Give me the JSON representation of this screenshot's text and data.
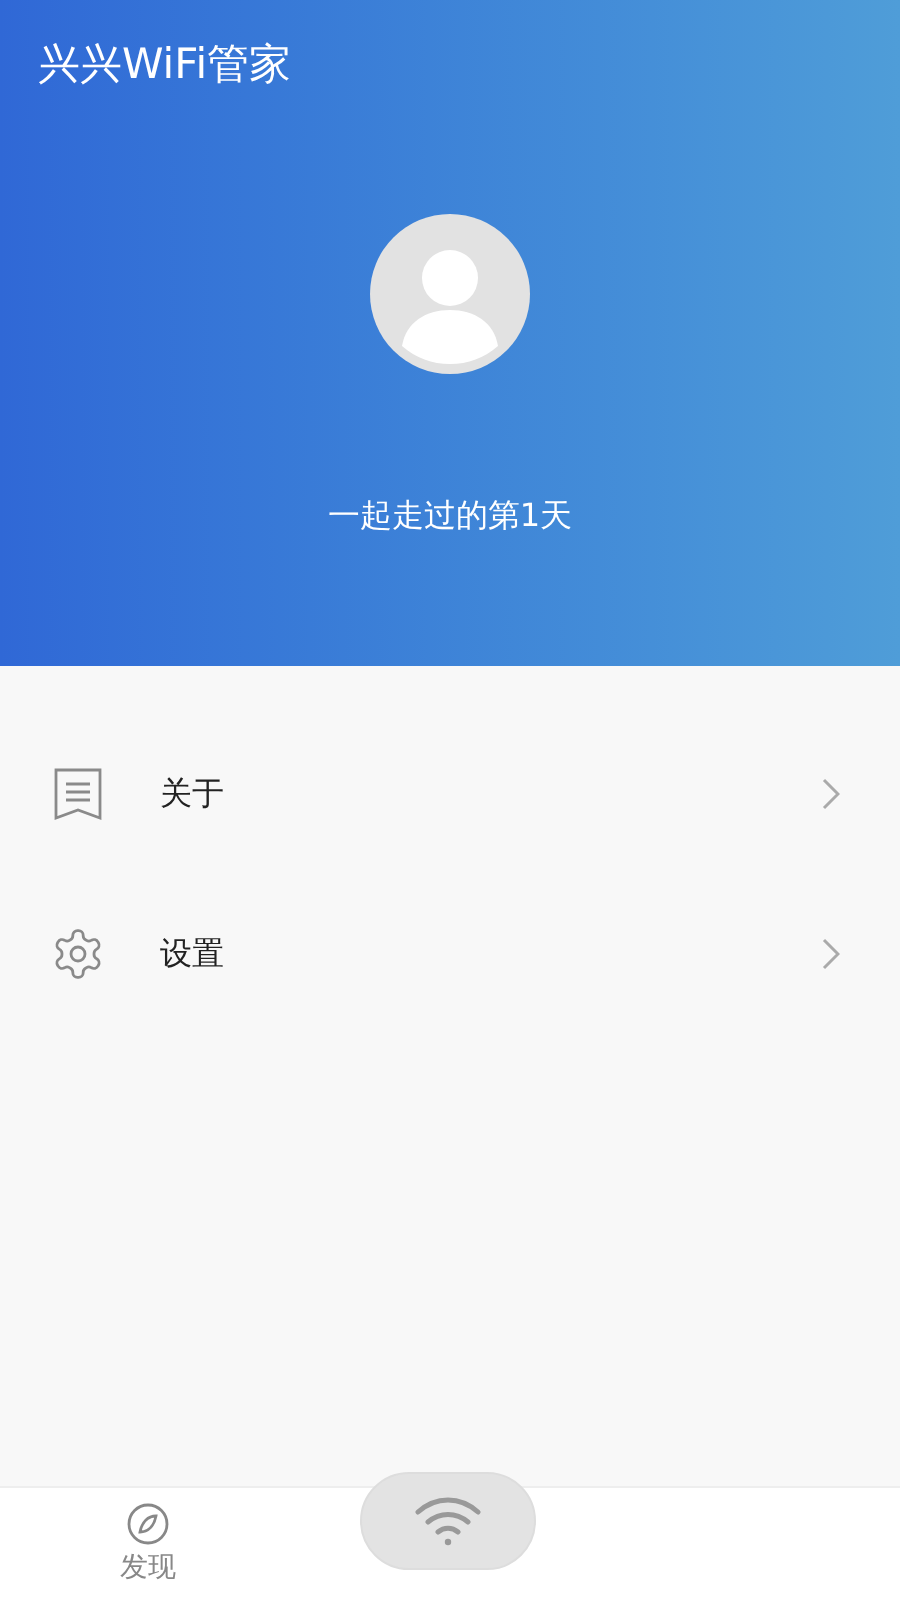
{
  "app_title": "兴兴WiFi管家",
  "profile": {
    "caption": "一起走过的第1天"
  },
  "menu": [
    {
      "kind": "document",
      "label": "关于"
    },
    {
      "kind": "gear",
      "label": "设置"
    }
  ],
  "bottom_nav": {
    "items": [
      {
        "kind": "compass",
        "label": "发现"
      }
    ]
  }
}
